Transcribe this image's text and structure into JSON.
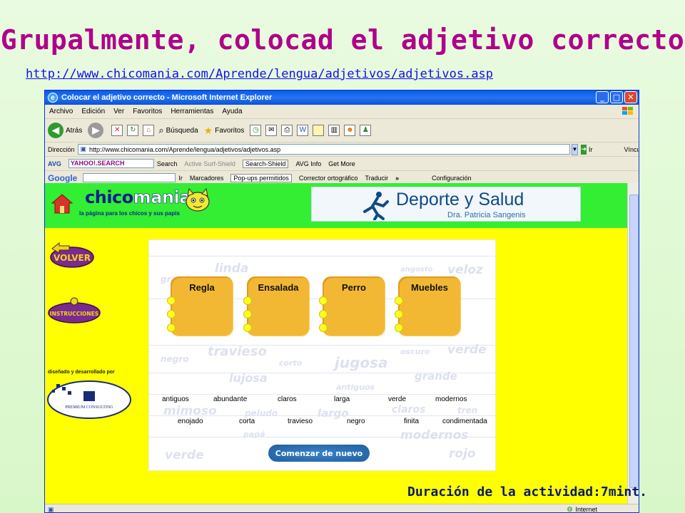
{
  "slide": {
    "title": "Grupalmente, colocad el adjetivo correcto",
    "link": "http://www.chicomania.com/Aprende/lengua/adjetivos/adjetivos.asp",
    "duration": "Duración de la actividad:7mint."
  },
  "browser": {
    "window_title": "Colocar el adjetivo correcto - Microsoft Internet Explorer",
    "menu": [
      "Archivo",
      "Edición",
      "Ver",
      "Favoritos",
      "Herramientas",
      "Ayuda"
    ],
    "toolbar": {
      "back": "Atrás",
      "search": "Búsqueda",
      "favorites": "Favoritos"
    },
    "address_label": "Dirección",
    "address_value": "http://www.chicomania.com/Aprende/lengua/adjetivos/adjetivos.asp",
    "go_label": "Ir",
    "links_label": "Vínculos",
    "yahoo_bar": {
      "avg": "AVG",
      "search_placeholder": "YAHOO!.SEARCH",
      "search": "Search",
      "active_surf": "Active Surf-Shield",
      "search_shield": "Search-Shield",
      "avg_info": "AVG Info",
      "get_more": "Get More"
    },
    "google_bar": {
      "logo": "Google",
      "go": "Ir",
      "bookmarks": "Marcadores",
      "popups": "Pop-ups permitidos",
      "spell": "Corrector ortográfico",
      "translate": "Traducir",
      "more": "»",
      "settings": "Configuración"
    },
    "status": "Internet"
  },
  "site": {
    "logo_text_a": "chico",
    "logo_text_b": "mania",
    "logo_sub": "la página para los chicos y sus papis",
    "sponsor_title": "Deporte y Salud",
    "sponsor_sub": "Dra. Patricia Sangenis",
    "volver": "VOLVER",
    "instrucciones": "INSTRUCCIONES",
    "credits": "diseñado y desarrollado por",
    "premium": "PREMIUM CONSULTING"
  },
  "activity": {
    "boxes": [
      "Regla",
      "Ensalada",
      "Perro",
      "Muebles"
    ],
    "words_row1": [
      "antiguos",
      "abundante",
      "claros",
      "larga",
      "verde",
      "modernos"
    ],
    "words_row2": [
      "enojado",
      "corta",
      "travieso",
      "negro",
      "finita",
      "condimentada"
    ],
    "restart": "Comenzar de nuevo",
    "watermarks": [
      "linda",
      "veloz",
      "angosto",
      "grande",
      "travieso",
      "jugosa",
      "verde",
      "negro",
      "corto",
      "oscuro",
      "grande",
      "lujosa",
      "antiguos",
      "mimoso",
      "peludo",
      "largo",
      "claros",
      "tren",
      "modernos",
      "papá",
      "verde",
      "rojo"
    ]
  },
  "colors": {
    "title": "#b0008a",
    "link": "#1010ee",
    "page_bg": "#ffff00",
    "header_bg": "#33ee33",
    "box": "#f3b833"
  }
}
